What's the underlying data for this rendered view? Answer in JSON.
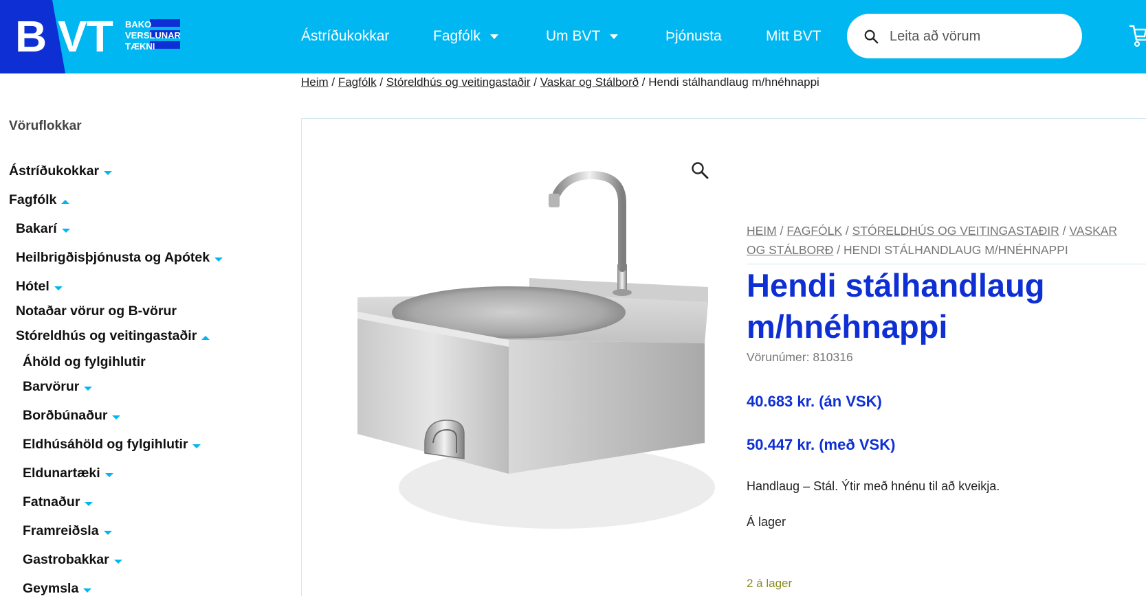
{
  "colors": {
    "header_bg": "#00b7f1",
    "brand_blue": "#0e2fd3",
    "arrow": "#00b7f1",
    "stock_green": "#8a8a1e"
  },
  "logo": {
    "letter_b": "B",
    "letters_vt": "VT",
    "line1": "BAKO",
    "line2": "VERSLUNAR",
    "line3": "TÆKNI"
  },
  "nav": {
    "items": [
      {
        "label": "Ástríðukokkar",
        "dropdown": false
      },
      {
        "label": "Fagfólk",
        "dropdown": true
      },
      {
        "label": "Um BVT",
        "dropdown": true
      },
      {
        "label": "Þjónusta",
        "dropdown": false
      },
      {
        "label": "Mitt BVT",
        "dropdown": false
      }
    ]
  },
  "search": {
    "placeholder": "Leita að vörum",
    "value": ""
  },
  "breadcrumb": {
    "links": [
      "Heim",
      "Fagfólk",
      "Stóreldhús og veitingastaðir",
      "Vaskar og Stálborð"
    ],
    "current": "Hendi stálhandlaug m/hnéhnappi",
    "separator": " / "
  },
  "sidebar": {
    "title": "Vöruflokkar",
    "categories": [
      {
        "label": "Ástríðukokkar",
        "arrow": "down",
        "level": 0
      },
      {
        "label": "Fagfólk",
        "arrow": "up",
        "level": 0
      },
      {
        "label": "Bakarí",
        "arrow": "down",
        "level": 1
      },
      {
        "label": "Heilbrigðisþjónusta og Apótek",
        "arrow": "down",
        "level": 1
      },
      {
        "label": "Hótel",
        "arrow": "down",
        "level": 1
      },
      {
        "label": "Notaðar vörur og B-vörur",
        "arrow": "none",
        "level": 1
      },
      {
        "label": "Stóreldhús og veitingastaðir",
        "arrow": "up",
        "level": 1
      },
      {
        "label": "Áhöld og fylgihlutir",
        "arrow": "none",
        "level": 2
      },
      {
        "label": "Barvörur",
        "arrow": "down",
        "level": 2
      },
      {
        "label": "Borðbúnaður",
        "arrow": "down",
        "level": 2
      },
      {
        "label": "Eldhúsáhöld og fylgihlutir",
        "arrow": "down",
        "level": 2
      },
      {
        "label": "Eldunartæki",
        "arrow": "down",
        "level": 2
      },
      {
        "label": "Fatnaður",
        "arrow": "down",
        "level": 2
      },
      {
        "label": "Framreiðsla",
        "arrow": "down",
        "level": 2
      },
      {
        "label": "Gastrobakkar",
        "arrow": "down",
        "level": 2
      },
      {
        "label": "Geymsla",
        "arrow": "down",
        "level": 2
      }
    ]
  },
  "product": {
    "breadcrumb_links": [
      "HEIM",
      "FAGFÓLK",
      "STÓRELDHÚS OG VEITINGASTAÐIR",
      "VASKAR OG STÁLBORÐ"
    ],
    "breadcrumb_current": "HENDI STÁLHANDLAUG M/HNÉHNAPPI",
    "title": "Hendi stálhandlaug m/hnéhnappi",
    "sku_label": "Vörunúmer:",
    "sku": "810316",
    "price_ex_vat": "40.683 kr.  (án VSK)",
    "price_inc_vat": "50.447 kr.  (með VSK)",
    "description": "Handlaug – Stál. Ýtir með hnénu til að kveikja.",
    "stock_status": "Á lager",
    "stock_count": "2 á lager",
    "image_icon": "stainless-sink-image",
    "zoom_icon": "magnifier-icon"
  }
}
